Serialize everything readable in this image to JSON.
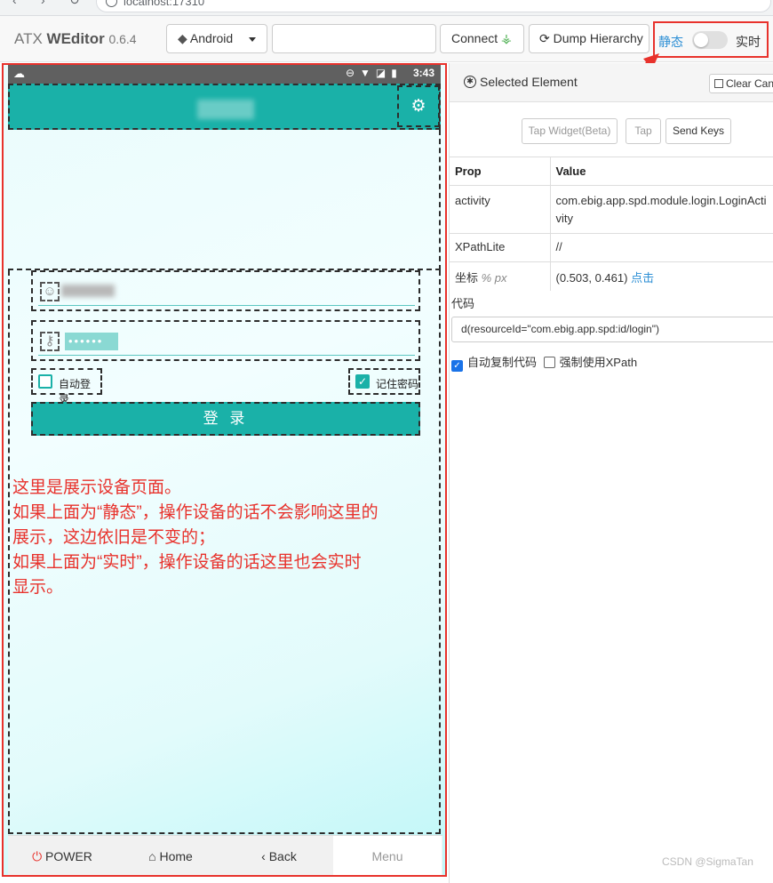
{
  "browser": {
    "url": "localhost:17310"
  },
  "toolbar": {
    "brand_name": "ATX",
    "brand_bold": "WEditor",
    "version": "0.6.4",
    "platform": "Android",
    "serial_value": "",
    "connect_label": "Connect",
    "dump_label": "Dump Hierarchy",
    "mode_static": "静态",
    "mode_live": "实时",
    "mode_live_enabled": false
  },
  "phone": {
    "status_time": "3:43",
    "password_mask": "••••••",
    "auto_login_label": "自动登录",
    "auto_login_checked": false,
    "remember_label": "记住密码",
    "remember_checked": true,
    "login_label": "登 录",
    "annotation": [
      "这里是展示设备页面。",
      "如果上面为“静态”，操作设备的话不会影响这里的",
      "展示，这边依旧是不变的；",
      "如果上面为“实时”，操作设备的话这里也会实时",
      "显示。"
    ]
  },
  "bottom_nav": {
    "power": "POWER",
    "home": "Home",
    "back": "Back",
    "menu": "Menu"
  },
  "inspector": {
    "header": "Selected Element",
    "clear_canvas": "Clear Canvas",
    "tap_widget": "Tap Widget(Beta)",
    "tap": "Tap",
    "send_keys": "Send Keys",
    "col_prop": "Prop",
    "col_value": "Value",
    "rows": {
      "activity": {
        "prop": "activity",
        "value": "com.ebig.app.spd.module.login.LoginActivity"
      },
      "xpath": {
        "prop": "XPathLite",
        "value": "//"
      },
      "coord": {
        "prop": "坐标",
        "unit": "% px",
        "value": "(0.503, 0.461)",
        "action": "点击"
      }
    },
    "code_label": "代码",
    "code_value": "d(resourceId=\"com.ebig.app.spd:id/login\")",
    "auto_copy_label": "自动复制代码",
    "auto_copy_checked": true,
    "force_xpath_label": "强制使用XPath",
    "force_xpath_checked": false
  },
  "watermark": "CSDN @SigmaTan",
  "colors": {
    "accent": "#1ab1a8",
    "annotation_red": "#e8322c",
    "link_blue": "#2d8fd5"
  }
}
